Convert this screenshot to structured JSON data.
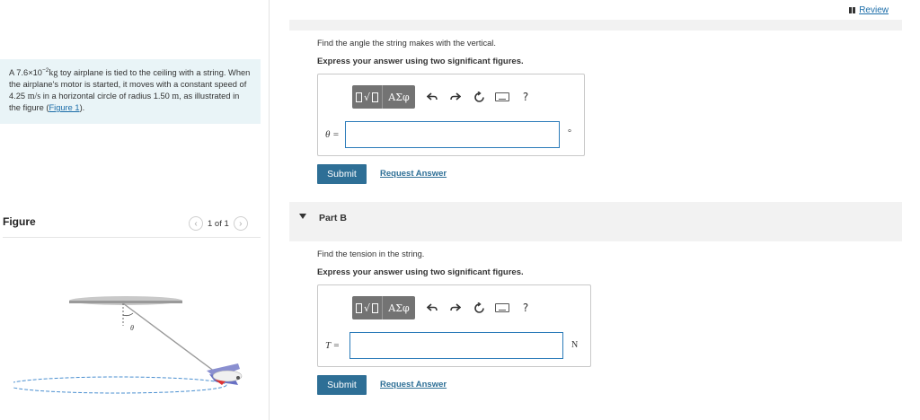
{
  "header": {
    "review_label": "Review"
  },
  "problem": {
    "text_a": "A 7.6×10",
    "exponent": "−2",
    "mass_unit": "kg",
    "text_b": " toy airplane is tied to the ceiling with a string. When the airplane's motor is started, it moves with a constant speed of 4.25 ",
    "speed_unit": "m/s",
    "text_c": " in a horizontal circle of radius 1.50 ",
    "radius_unit": "m",
    "text_d": ", as illustrated in the figure (",
    "figure_link": "Figure 1",
    "text_e": ")."
  },
  "figure": {
    "title": "Figure",
    "pager": "1 of 1",
    "prev_icon": "chevron-left-icon",
    "next_icon": "chevron-right-icon",
    "angle_label": "θ"
  },
  "part_a": {
    "question": "Find the angle the string makes with the vertical.",
    "instruction": "Express your answer using two significant figures.",
    "variable": "θ =",
    "input_value": "",
    "unit": "°",
    "submit_label": "Submit",
    "request_label": "Request Answer"
  },
  "part_b": {
    "title": "Part B",
    "question": "Find the tension in the string.",
    "instruction": "Express your answer using two significant figures.",
    "variable": "T =",
    "input_value": "",
    "unit": "N",
    "submit_label": "Submit",
    "request_label": "Request Answer"
  },
  "toolbar": {
    "greek_label": "ΑΣφ",
    "root_glyph": "√",
    "help_label": "?",
    "icons": [
      "fraction-root-icon",
      "greek-letters-icon",
      "undo-icon",
      "redo-icon",
      "reset-icon",
      "keyboard-icon",
      "help-icon"
    ]
  },
  "colors": {
    "accent": "#2e6f96",
    "link": "#1a6ca8",
    "problem_bg": "#e9f4f7",
    "toolbar_gray": "#737373",
    "input_border": "#2b7bb9"
  }
}
